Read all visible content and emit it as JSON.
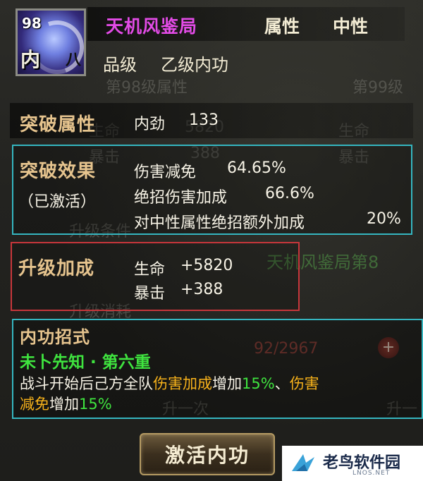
{
  "background": {
    "ghost_texts": [
      "第98级属性",
      "第99级",
      "生命",
      "5820",
      "生命",
      "暴击",
      "388",
      "暴击",
      "升级条件",
      "天机风鉴局第8",
      "升级消耗",
      "92/2967",
      "升一次",
      "升一"
    ]
  },
  "header": {
    "level": "98",
    "type_char": "内",
    "eight_char": "八",
    "skill_name": "天机风鉴局",
    "attr_label": "属性",
    "attr_value": "中性",
    "grade_label": "品级",
    "grade_value": "乙级内功",
    "name_color": "#e24be6"
  },
  "breakthrough_attr": {
    "title": "突破属性",
    "stat_name": "内劲",
    "stat_value": "133"
  },
  "breakthrough_effect": {
    "title": "突破效果",
    "status": "（已激活）",
    "lines": [
      {
        "label": "伤害减免",
        "value": "64.65%"
      },
      {
        "label": "绝招伤害加成",
        "value": "66.6%"
      },
      {
        "label": "对中性属性绝招额外加成",
        "value": "20%"
      }
    ],
    "border_color": "#35b6c0"
  },
  "upgrade_bonus": {
    "title": "升级加成",
    "lines": [
      {
        "label": "生命",
        "value": "+5820"
      },
      {
        "label": "暴击",
        "value": "+388"
      }
    ],
    "border_color": "#c7363b"
  },
  "skill_move": {
    "title": "内功招式",
    "move_name": "未卜先知 · 第六重",
    "desc_parts": {
      "p1": "战斗开始后己方全队",
      "p2": "伤害加成",
      "p3": "增加",
      "p4": "15%",
      "p5": "、",
      "p6": "伤害",
      "p7": "减免",
      "p8": "增加",
      "p9": "15%"
    }
  },
  "activate_button": {
    "label": "激活内功"
  },
  "watermark": {
    "text": "老鸟软件园",
    "sub": "LNOS.NET"
  },
  "icons": {
    "plus": "+"
  }
}
